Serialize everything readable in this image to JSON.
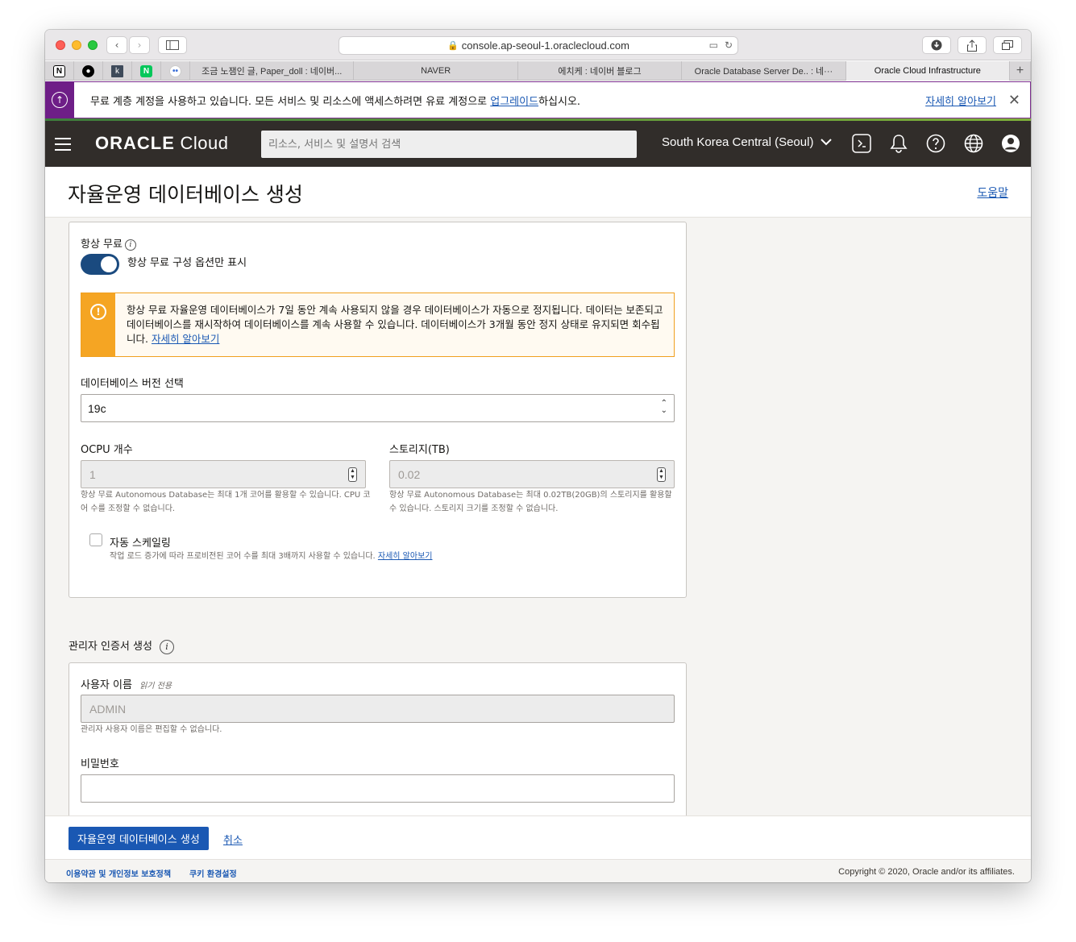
{
  "browser": {
    "url": "console.ap-seoul-1.oraclecloud.com",
    "tabs": [
      {
        "label": "조금 노잼인 글, Paper_doll : 네이버...",
        "active": false
      },
      {
        "label": "NAVER",
        "active": false
      },
      {
        "label": "에치케 : 네이버 블로그",
        "active": false
      },
      {
        "label": "Oracle Database Server De.. : 네···",
        "active": false
      },
      {
        "label": "Oracle Cloud Infrastructure",
        "active": true
      }
    ],
    "new_tab": "+"
  },
  "notice": {
    "text_before": "무료 계층 계정을 사용하고 있습니다. 모든 서비스 및 리소스에 액세스하려면 유료 계정으로 ",
    "link": "업그레이드",
    "text_after": "하십시오.",
    "learn_more": "자세히 알아보기",
    "close": "✕"
  },
  "header": {
    "logo_brand": "ORACLE",
    "logo_product": "Cloud",
    "search_placeholder": "리소스, 서비스 및 설명서 검색",
    "region": "South Korea Central (Seoul)"
  },
  "page": {
    "title": "자율운영 데이터베이스 생성",
    "help": "도움말"
  },
  "always_free": {
    "label": "항상 무료",
    "toggle_label": "항상 무료 구성 옵션만 표시",
    "warning": "항상 무료 자율운영 데이터베이스가 7일 동안 계속 사용되지 않을 경우 데이터베이스가 자동으로 정지됩니다. 데이터는 보존되고 데이터베이스를 재시작하여 데이터베이스를 계속 사용할 수 있습니다. 데이터베이스가 3개월 동안 정지 상태로 유지되면 회수됩니다. ",
    "warning_link": "자세히 알아보기"
  },
  "db_version": {
    "label": "데이터베이스 버전 선택",
    "value": "19c"
  },
  "ocpu": {
    "label": "OCPU 개수",
    "value": "1",
    "hint": "항상 무료 Autonomous Database는 최대 1개 코어를 활용할 수 있습니다. CPU 코어 수를 조정할 수 없습니다."
  },
  "storage": {
    "label": "스토리지(TB)",
    "value": "0.02",
    "hint": "항상 무료 Autonomous Database는 최대 0.02TB(20GB)의 스토리지를 활용할 수 있습니다. 스토리지 크기를 조정할 수 없습니다."
  },
  "autoscaling": {
    "label": "자동 스케일링",
    "hint": "작업 로드 증가에 따라 프로비전된 코어 수를 최대 3배까지 사용할 수 있습니다. ",
    "link": "자세히 알아보기"
  },
  "admin": {
    "section_title": "관리자 인증서 생성",
    "username_label": "사용자 이름",
    "readonly_tag": "읽기 전용",
    "username_value": "ADMIN",
    "username_hint": "관리자 사용자 이름은 편집할 수 없습니다.",
    "password_label": "비밀번호"
  },
  "actions": {
    "create": "자율운영 데이터베이스 생성",
    "cancel": "취소"
  },
  "footer": {
    "terms": "이용약관 및 개인정보 보호정책",
    "cookies": "쿠키 환경설정",
    "copyright": "Copyright © 2020, Oracle and/or its affiliates."
  },
  "colors": {
    "header_bg": "#312d2a",
    "primary": "#1a58b3",
    "notice_accent": "#6e1e87",
    "warning_accent": "#f5a523"
  }
}
